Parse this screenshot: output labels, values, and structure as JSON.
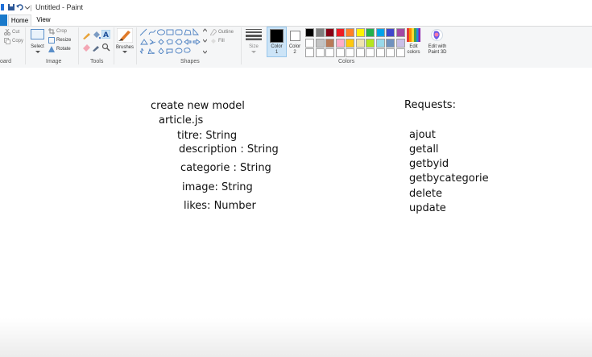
{
  "title": "Untitled - Paint",
  "tabs": {
    "file": "",
    "home": "Home",
    "view": "View"
  },
  "clipboard": {
    "cut": "Cut",
    "copy": "Copy",
    "group": "oard"
  },
  "image": {
    "select": "Select",
    "crop": "Crop",
    "resize": "Resize",
    "rotate": "Rotate",
    "group": "Image"
  },
  "tools": {
    "group": "Tools"
  },
  "brushes": {
    "label": "Brushes"
  },
  "shapes": {
    "outline": "Outline",
    "fill": "Fill",
    "group": "Shapes"
  },
  "size": {
    "label": "Size"
  },
  "color1": {
    "label": "Color",
    "num": "1",
    "value": "#000000"
  },
  "color2": {
    "label": "Color",
    "num": "2",
    "value": "#ffffff"
  },
  "colors": {
    "group": "Colors",
    "row1": [
      "#000000",
      "#7f7f7f",
      "#880015",
      "#ed1c24",
      "#ff7f27",
      "#fff200",
      "#22b14c",
      "#00a2e8",
      "#3f48cc",
      "#a349a4"
    ],
    "row2": [
      "#ffffff",
      "#c3c3c3",
      "#b97a57",
      "#ffaec9",
      "#ffc90e",
      "#efe4b0",
      "#b5e61d",
      "#99d9ea",
      "#7092be",
      "#c8bfe7"
    ],
    "row3": [
      "#ffffff",
      "#ffffff",
      "#ffffff",
      "#ffffff",
      "#ffffff",
      "#ffffff",
      "#ffffff",
      "#ffffff",
      "#ffffff",
      "#ffffff"
    ]
  },
  "edit_colors": {
    "line1": "Edit",
    "line2": "colors"
  },
  "paint3d": {
    "line1": "Edit with",
    "line2": "Paint 3D"
  },
  "canvas": {
    "left": [
      "create new model",
      "article.js",
      "titre: String",
      "description : String",
      "categorie : String",
      "image: String",
      "likes: Number"
    ],
    "right_title": "Requests:",
    "right": [
      "ajout",
      "getall",
      "getbyid",
      "getbycategorie",
      "delete",
      "update"
    ]
  }
}
